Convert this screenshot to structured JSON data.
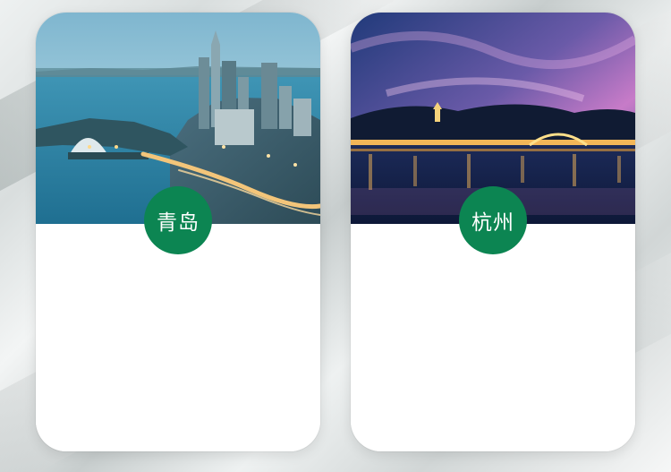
{
  "cities": [
    {
      "name": "青岛",
      "image_icon": "qingdao-coastline-skyline-photo"
    },
    {
      "name": "杭州",
      "image_icon": "hangzhou-west-lake-night-photo"
    }
  ],
  "colors": {
    "badge": "#0c8552",
    "card": "#ffffff",
    "badge_text": "#ffffff"
  }
}
